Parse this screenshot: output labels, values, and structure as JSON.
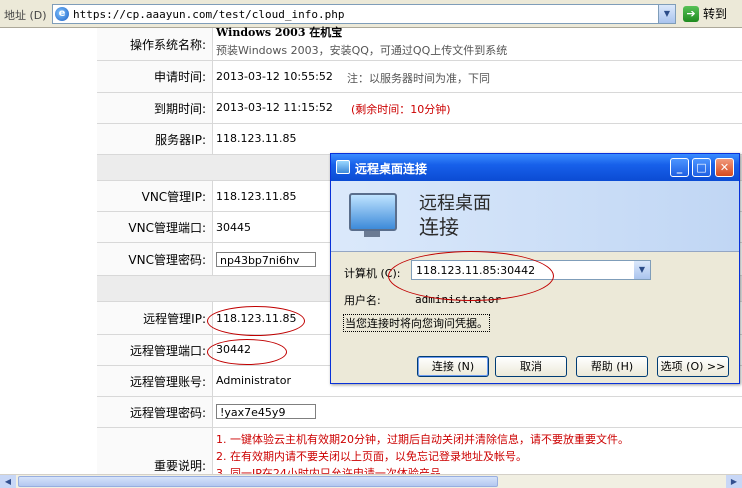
{
  "address_bar": {
    "label": "地址 (D)",
    "url": "https://cp.aaayun.com/test/cloud_info.php",
    "go_label": "转到"
  },
  "rows": {
    "os": {
      "label": "操作系统名称:",
      "value_title": "Windows 2003 在机宝",
      "value_desc": "预装Windows 2003，安装QQ，可通过QQ上传文件到系统"
    },
    "apply_time": {
      "label": "申请时间:",
      "value": "2013-03-12 10:55:52",
      "note": "注：以服务器时间为准，下同"
    },
    "expire_time": {
      "label": "到期时间:",
      "value": "2013-03-12 11:15:52",
      "remaining": "(剩余时间：10分钟)"
    },
    "server_ip": {
      "label": "服务器IP:",
      "value": "118.123.11.85"
    },
    "vnc_ip": {
      "label": "VNC管理IP:",
      "value": "118.123.11.85"
    },
    "vnc_port": {
      "label": "VNC管理端口:",
      "value": "30445"
    },
    "vnc_password": {
      "label": "VNC管理密码:",
      "value": "np43bp7ni6hv"
    },
    "remote_ip": {
      "label": "远程管理IP:",
      "value": "118.123.11.85"
    },
    "remote_port": {
      "label": "远程管理端口:",
      "value": "30442"
    },
    "remote_account": {
      "label": "远程管理账号:",
      "value": "Administrator"
    },
    "remote_password": {
      "label": "远程管理密码:",
      "value": "!yax7e45y9"
    },
    "notes": {
      "label": "重要说明:",
      "items": [
        "1. 一键体验云主机有效期20分钟，过期后自动关闭并清除信息，请不要放重要文件。",
        "2. 在有效期内请不要关闭以上页面，以免忘记登录地址及帐号。",
        "3. 同一IP在24小时内只允许申请一次体验产品"
      ]
    }
  },
  "dialog": {
    "title": "远程桌面连接",
    "banner_line1": "远程桌面",
    "banner_line2": "连接",
    "computer_label": "计算机 (C):",
    "computer_value": "118.123.11.85:30442",
    "username_label": "用户名:",
    "username_value": "administrator",
    "credential_note": "当您连接时将向您询问凭据。",
    "buttons": {
      "connect": "连接 (N)",
      "cancel": "取消",
      "help": "帮助 (H)",
      "options": "选项 (O) >>"
    }
  }
}
